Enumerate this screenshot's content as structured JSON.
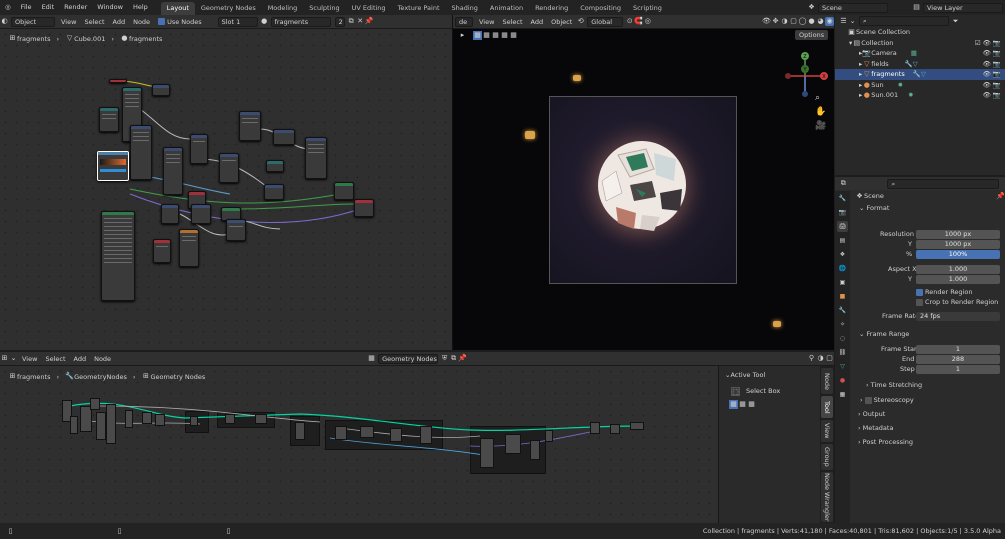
{
  "topbar": {
    "menus": [
      "File",
      "Edit",
      "Render",
      "Window",
      "Help"
    ],
    "workspaces": [
      "Layout",
      "Geometry Nodes",
      "Modeling",
      "Sculpting",
      "UV Editing",
      "Texture Paint",
      "Shading",
      "Animation",
      "Rendering",
      "Compositing",
      "Scripting"
    ],
    "active_workspace": "Layout",
    "scene_name": "Scene",
    "view_layer": "View Layer"
  },
  "node_editor_top": {
    "mode": "Object",
    "menus": [
      "View",
      "Select",
      "Add",
      "Node"
    ],
    "use_nodes_label": "Use Nodes",
    "slot": "Slot 1",
    "material": "fragments",
    "user_count": "2",
    "breadcrumb": [
      "fragments",
      "Cube.001",
      "fragments"
    ]
  },
  "viewport": {
    "mode": "de",
    "menus": [
      "View",
      "Select",
      "Add",
      "Object"
    ],
    "orientation": "Global",
    "options_label": "Options",
    "gizmo_axes": [
      "Z",
      "Y",
      "X"
    ]
  },
  "outliner": {
    "root": "Scene Collection",
    "collection": "Collection",
    "items": [
      {
        "name": "Camera",
        "icon": "camera-icon",
        "selected": false
      },
      {
        "name": "fields",
        "icon": "mesh-icon",
        "selected": false
      },
      {
        "name": "fragments",
        "icon": "mesh-icon",
        "selected": true
      },
      {
        "name": "Sun",
        "icon": "light-icon",
        "selected": false
      },
      {
        "name": "Sun.001",
        "icon": "light-icon",
        "selected": false
      }
    ]
  },
  "properties": {
    "context": "Scene",
    "format_panel": "Format",
    "resolution_x_label": "Resolution X",
    "resolution_x": "1000 px",
    "resolution_y_label": "Y",
    "resolution_y": "1000 px",
    "percent_label": "%",
    "percent": "100%",
    "aspect_x_label": "Aspect X",
    "aspect_x": "1.000",
    "aspect_y_label": "Y",
    "aspect_y": "1.000",
    "render_region": "Render Region",
    "crop_region": "Crop to Render Region",
    "frame_rate_label": "Frame Rate",
    "frame_rate": "24 fps",
    "frame_range_panel": "Frame Range",
    "frame_start_label": "Frame Start",
    "frame_start": "1",
    "end_label": "End",
    "end": "288",
    "step_label": "Step",
    "step": "1",
    "collapsed_panels": [
      "Time Stretching",
      "Stereoscopy",
      "Output",
      "Metadata",
      "Post Processing"
    ]
  },
  "node_editor_bottom": {
    "menus": [
      "View",
      "Select",
      "Add",
      "Node"
    ],
    "node_tree": "Geometry Nodes",
    "breadcrumb": [
      "fragments",
      "GeometryNodes",
      "Geometry Nodes"
    ]
  },
  "sidebar": {
    "panel": "Active Tool",
    "tool": "Select Box",
    "tabs": [
      "Node",
      "Tool",
      "View",
      "Group",
      "Node Wrangler"
    ],
    "active_tab": "Tool"
  },
  "statusbar": {
    "text": "Collection | fragments | Verts:41,180 | Faces:40,801 | Tris:81,602 | Objects:1/5 | 3.5.0 Alpha"
  },
  "colors": {
    "accent": "#4772b3",
    "selection": "#334d80",
    "geometry_socket": "#00d6a3"
  }
}
